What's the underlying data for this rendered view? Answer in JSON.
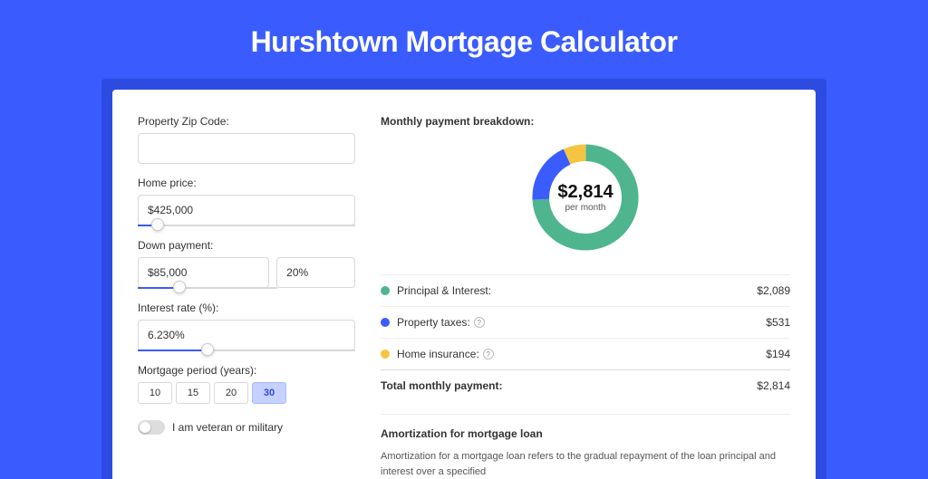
{
  "title": "Hurshtown Mortgage Calculator",
  "form": {
    "zip_label": "Property Zip Code:",
    "zip_value": "",
    "home_price_label": "Home price:",
    "home_price_value": "$425,000",
    "home_price_slider_pct": 9,
    "down_payment_label": "Down payment:",
    "down_payment_value": "$85,000",
    "down_payment_pct_value": "20%",
    "down_payment_slider_pct": 30,
    "interest_label": "Interest rate (%):",
    "interest_value": "6.230%",
    "interest_slider_pct": 32,
    "period_label": "Mortgage period (years):",
    "periods": [
      "10",
      "15",
      "20",
      "30"
    ],
    "period_selected": "30",
    "veteran_label": "I am veteran or military"
  },
  "breakdown": {
    "title": "Monthly payment breakdown:",
    "center_amount": "$2,814",
    "center_sub": "per month",
    "items": [
      {
        "label": "Principal & Interest:",
        "value": "$2,089",
        "color": "#4eb58f",
        "help": false
      },
      {
        "label": "Property taxes:",
        "value": "$531",
        "color": "#3a5cff",
        "help": true
      },
      {
        "label": "Home insurance:",
        "value": "$194",
        "color": "#f5c542",
        "help": true
      }
    ],
    "total_label": "Total monthly payment:",
    "total_value": "$2,814"
  },
  "chart_data": {
    "type": "pie",
    "title": "Monthly payment breakdown",
    "series": [
      {
        "name": "Principal & Interest",
        "value": 2089,
        "color": "#4eb58f"
      },
      {
        "name": "Property taxes",
        "value": 531,
        "color": "#3a5cff"
      },
      {
        "name": "Home insurance",
        "value": 194,
        "color": "#f5c542"
      }
    ],
    "total": 2814,
    "center_label": "$2,814 per month"
  },
  "amortization": {
    "title": "Amortization for mortgage loan",
    "text": "Amortization for a mortgage loan refers to the gradual repayment of the loan principal and interest over a specified"
  }
}
